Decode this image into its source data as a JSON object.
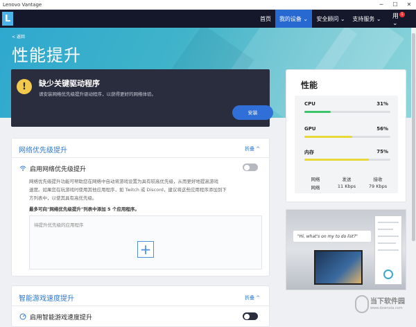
{
  "window": {
    "title": "Lenovo Vantage",
    "minimize": "─",
    "maximize": "☐",
    "close": "✕"
  },
  "nav": {
    "logo": "L",
    "items": [
      {
        "label": "首页"
      },
      {
        "label": "我的设备 ⌄"
      },
      {
        "label": "安全顾问 ⌄"
      },
      {
        "label": "支持服务 ⌄"
      }
    ],
    "user": "用 ⌄",
    "badge": "1"
  },
  "hero": {
    "back": "< 返回",
    "title": "性能提升"
  },
  "alert": {
    "icon": "!",
    "title": "缺少关键驱动程序",
    "desc": "请安装网络优先级提升驱动程序，以获得更好的网络体验。",
    "button": "安装"
  },
  "network_priority": {
    "title": "网络优先级提升",
    "collapse": "折叠 ^",
    "toggle_label": "启用网络优先级提升",
    "desc": [
      "网络优先级提升功能可帮助您在网络中自动将游戏设置为具有较高优先级，从而更好地提高游戏",
      "速度。如果您在玩游戏时使用其他应用程序，如 Twitch 或 Discord，建议将这些应用程序添加到下",
      "方列表中，以使其具有高优先级。"
    ],
    "note": "最多可向\"网络优先级提升\"列表中添加 5 个应用程序。",
    "list_placeholder": "待提升优先级的应用程序",
    "add": "+"
  },
  "game_speed": {
    "title": "智能游戏速度提升",
    "collapse": "折叠 ^",
    "toggle_label": "启用智能游戏速度提升"
  },
  "performance": {
    "title": "性能",
    "metrics": [
      {
        "name": "CPU",
        "value": "31%",
        "fraction": 0.31,
        "color": "#3cc46b"
      },
      {
        "name": "GPU",
        "value": "56%",
        "fraction": 0.56,
        "color": "#e8d83a"
      },
      {
        "name": "内存",
        "value": "75%",
        "fraction": 0.75,
        "color": "#e8d83a"
      }
    ],
    "network": {
      "headers": [
        "网络",
        "发送",
        "接收"
      ],
      "values": [
        "网络",
        "11 Kbps",
        "79 Kbps"
      ]
    }
  },
  "promo": {
    "bubble": "\"Hi, what's on my to do list?\""
  },
  "watermark": {
    "text": "当下软件园",
    "sub": "www.downxia.com"
  }
}
